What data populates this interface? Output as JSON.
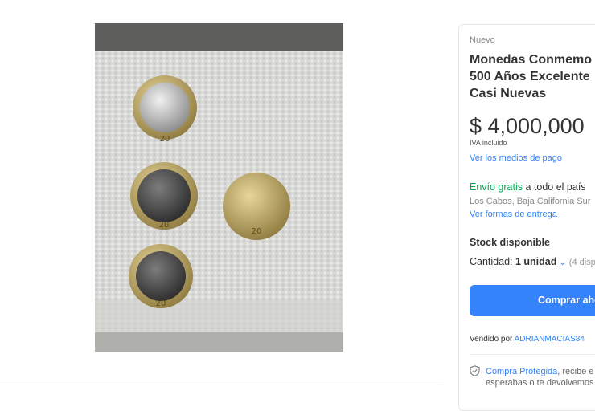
{
  "product": {
    "condition": "Nuevo",
    "title": "Monedas Conmemo\n500 Años Excelente\nCasi Nuevas",
    "price": "$ 4,000,000",
    "tax_note": "IVA incluido",
    "payment_link": "Ver los medios de pago"
  },
  "shipping": {
    "free_label": "Envío gratis",
    "scope": " a todo el país",
    "location": "Los Cabos, Baja California Sur",
    "delivery_link": "Ver formas de entrega"
  },
  "stock": {
    "label": "Stock disponible",
    "quantity_label": "Cantidad: ",
    "quantity_value": "1 unidad",
    "available": "(4 disp"
  },
  "buy_button": {
    "label": "Comprar ahora"
  },
  "seller": {
    "prefix": "Vendido por ",
    "name": "ADRIANMACIAS84"
  },
  "protection": {
    "link": "Compra Protegida",
    "line1_rest": ", recibe e",
    "line2": "esperabas o te devolvemos"
  },
  "colors": {
    "accent": "#3483fa",
    "free_shipping": "#00a650"
  },
  "icons": {
    "chevron": "chevron-down-icon",
    "shield": "shield-check-icon"
  }
}
